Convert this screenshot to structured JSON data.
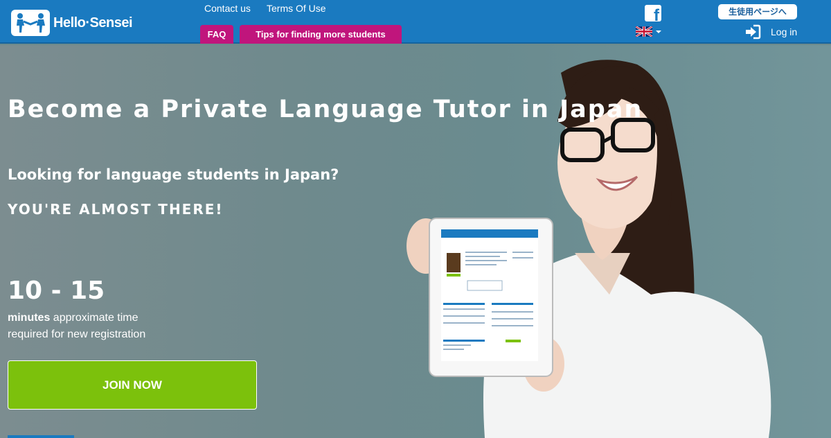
{
  "header": {
    "logo_text": "Hello·Sensei",
    "nav": {
      "contact": "Contact us",
      "terms": "Terms Of Use"
    },
    "tabs": {
      "faq": "FAQ",
      "tips": "Tips for finding more students"
    },
    "facebook_icon": "facebook-icon",
    "language_icon": "uk-flag-icon",
    "student_page_button": "生徒用ページへ",
    "login_label": "Log in",
    "login_icon": "sign-in-icon"
  },
  "hero": {
    "title": "Become a Private Language Tutor in Japan",
    "subtitle": "Looking for language students in Japan?",
    "cta_heading": "YOU'RE ALMOST THERE!",
    "time_range": "10 - 15",
    "time_unit": "minutes",
    "time_desc_1": "approximate time",
    "time_desc_2": "required for new registration",
    "join_button": "JOIN NOW"
  },
  "colors": {
    "header_bg": "#1a7ac0",
    "pill_bg": "#c0157c",
    "join_bg": "#7cc10c"
  }
}
